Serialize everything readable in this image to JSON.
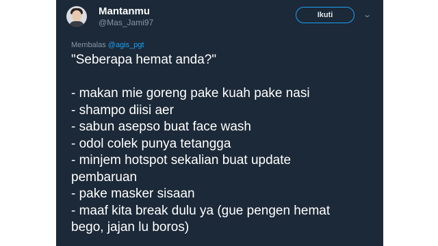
{
  "header": {
    "display_name": "Mantanmu",
    "handle": "@Mas_Jami97",
    "follow_label": "Ikuti",
    "menu_icon": "chevron-down-icon"
  },
  "reply": {
    "prefix": "Membalas ",
    "mention": "@agis_pgt"
  },
  "tweet": {
    "question": "\"Seberapa hemat anda?\"",
    "lines": [
      "- makan mie goreng pake kuah pake nasi",
      "- shampo diisi aer",
      "- sabun asepso buat face wash",
      "- odol colek punya tetangga",
      "- minjem hotspot sekalian buat update",
      "pembaruan",
      "- pake masker sisaan",
      "- maaf kita break dulu ya (gue pengen hemat",
      "bego, jajan lu boros)"
    ]
  },
  "colors": {
    "card_bg": "#1c2938",
    "accent": "#1da1f2",
    "muted": "#8899a6",
    "text": "#ffffff"
  }
}
